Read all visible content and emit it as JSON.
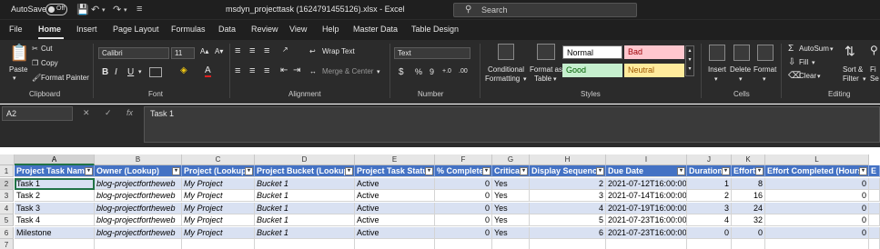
{
  "titlebar": {
    "autosave_label": "AutoSave",
    "autosave_state": "Off",
    "doc_title": "msdyn_projecttask (1624791455126).xlsx  -  Excel",
    "search_placeholder": "Search"
  },
  "tabs": [
    "File",
    "Home",
    "Insert",
    "Page Layout",
    "Formulas",
    "Data",
    "Review",
    "View",
    "Help",
    "Master Data",
    "Table Design"
  ],
  "active_tab": "Home",
  "ribbon": {
    "clipboard": {
      "label": "Clipboard",
      "paste": "Paste",
      "cut": "Cut",
      "copy": "Copy",
      "format_painter": "Format Painter"
    },
    "font": {
      "label": "Font",
      "name": "Calibri",
      "size": "11",
      "bold": "B",
      "italic": "I",
      "underline": "U"
    },
    "alignment": {
      "label": "Alignment",
      "wrap_text": "Wrap Text",
      "merge_center": "Merge & Center"
    },
    "number": {
      "label": "Number",
      "format": "Text",
      "percent": "%",
      "comma": "9",
      "inc": "+.0",
      "dec": ".00"
    },
    "styles": {
      "label": "Styles",
      "conditional_line1": "Conditional",
      "conditional_line2": "Formatting",
      "format_as_line1": "Format as",
      "format_as_line2": "Table",
      "normal": "Normal",
      "bad": "Bad",
      "good": "Good",
      "neutral": "Neutral"
    },
    "cells": {
      "label": "Cells",
      "insert": "Insert",
      "delete": "Delete",
      "format": "Format"
    },
    "editing": {
      "label": "Editing",
      "autosum": "AutoSum",
      "fill": "Fill",
      "clear": "Clear",
      "sort_line1": "Sort &",
      "sort_line2": "Filter",
      "find_line1": "Fi",
      "find_line2": "Se"
    }
  },
  "formula_bar": {
    "name_box": "A2",
    "fx": "fx",
    "content": "Task 1"
  },
  "grid": {
    "columns": [
      "A",
      "B",
      "C",
      "D",
      "E",
      "F",
      "G",
      "H",
      "I",
      "J",
      "K",
      "L"
    ],
    "row_numbers": [
      "1",
      "2",
      "3",
      "4",
      "5",
      "6",
      "7"
    ],
    "headers": [
      "Project Task Name",
      "Owner (Lookup)",
      "Project (Lookup)",
      "Project Bucket (Lookup)",
      "Project Task Status",
      "% Complete",
      "Critical",
      "Display Sequence",
      "Due Date",
      "Duration",
      "Effort",
      "Effort Completed (Hours)",
      "E"
    ],
    "rows": [
      [
        "Task 1",
        "blog-projectfortheweb",
        "My Project",
        "Bucket 1",
        "Active",
        "0",
        "Yes",
        "2",
        "2021-07-12T16:00:00Z",
        "1",
        "8",
        "0"
      ],
      [
        "Task 2",
        "blog-projectfortheweb",
        "My Project",
        "Bucket 1",
        "Active",
        "0",
        "Yes",
        "3",
        "2021-07-14T16:00:00Z",
        "2",
        "16",
        "0"
      ],
      [
        "Task 3",
        "blog-projectfortheweb",
        "My Project",
        "Bucket 1",
        "Active",
        "0",
        "Yes",
        "4",
        "2021-07-19T16:00:00Z",
        "3",
        "24",
        "0"
      ],
      [
        "Task 4",
        "blog-projectfortheweb",
        "My Project",
        "Bucket 1",
        "Active",
        "0",
        "Yes",
        "5",
        "2021-07-23T16:00:00Z",
        "4",
        "32",
        "0"
      ],
      [
        "Milestone",
        "blog-projectfortheweb",
        "My Project",
        "Bucket 1",
        "Active",
        "0",
        "Yes",
        "6",
        "2021-07-23T16:00:00Z",
        "0",
        "0",
        "0"
      ]
    ]
  },
  "colors": {
    "table_header": "#4472c4",
    "band": "#d9e1f2",
    "accent": "#217346"
  }
}
